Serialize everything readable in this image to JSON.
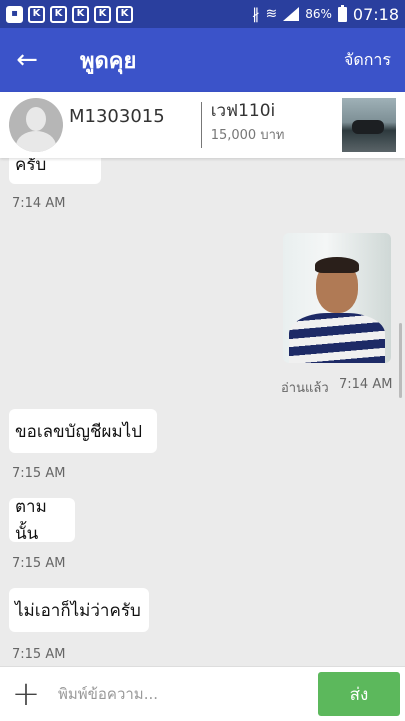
{
  "status_bar": {
    "notification_icons": [
      "image-icon",
      "k-icon",
      "k-icon",
      "k-icon",
      "k-icon",
      "k-icon"
    ],
    "k_letter": "K",
    "bluetooth": "∦",
    "wifi": "≋",
    "battery_pct": "86%",
    "time": "07:18"
  },
  "app_bar": {
    "back_glyph": "←",
    "title": "พูดคุย",
    "action": "จัดการ"
  },
  "listing": {
    "user_id": "M1303015",
    "item_name": "เวฟ110i",
    "item_price": "15,000 บาท"
  },
  "chat": {
    "messages": [
      {
        "side": "in",
        "text": "ตามใจครับ",
        "time": "7:14 AM"
      },
      {
        "side": "out",
        "type": "photo",
        "read_status": "อ่านแล้ว",
        "time": "7:14 AM"
      },
      {
        "side": "in",
        "text": "ขอเลขบัญชีผมไป",
        "time": "7:15 AM"
      },
      {
        "side": "in",
        "text": "ตามนั้น",
        "time": "7:15 AM"
      },
      {
        "side": "in",
        "text": "ไม่เอาก็ไม่ว่าครับ",
        "time": "7:15 AM"
      }
    ]
  },
  "composer": {
    "plus_glyph": "+",
    "placeholder": "พิมพ์ข้อความ...",
    "send_label": "ส่ง"
  },
  "colors": {
    "status_bar": "#2a3f9e",
    "app_bar": "#3b53c9",
    "chat_bg": "#ebebeb",
    "send_button": "#5cb85c"
  }
}
